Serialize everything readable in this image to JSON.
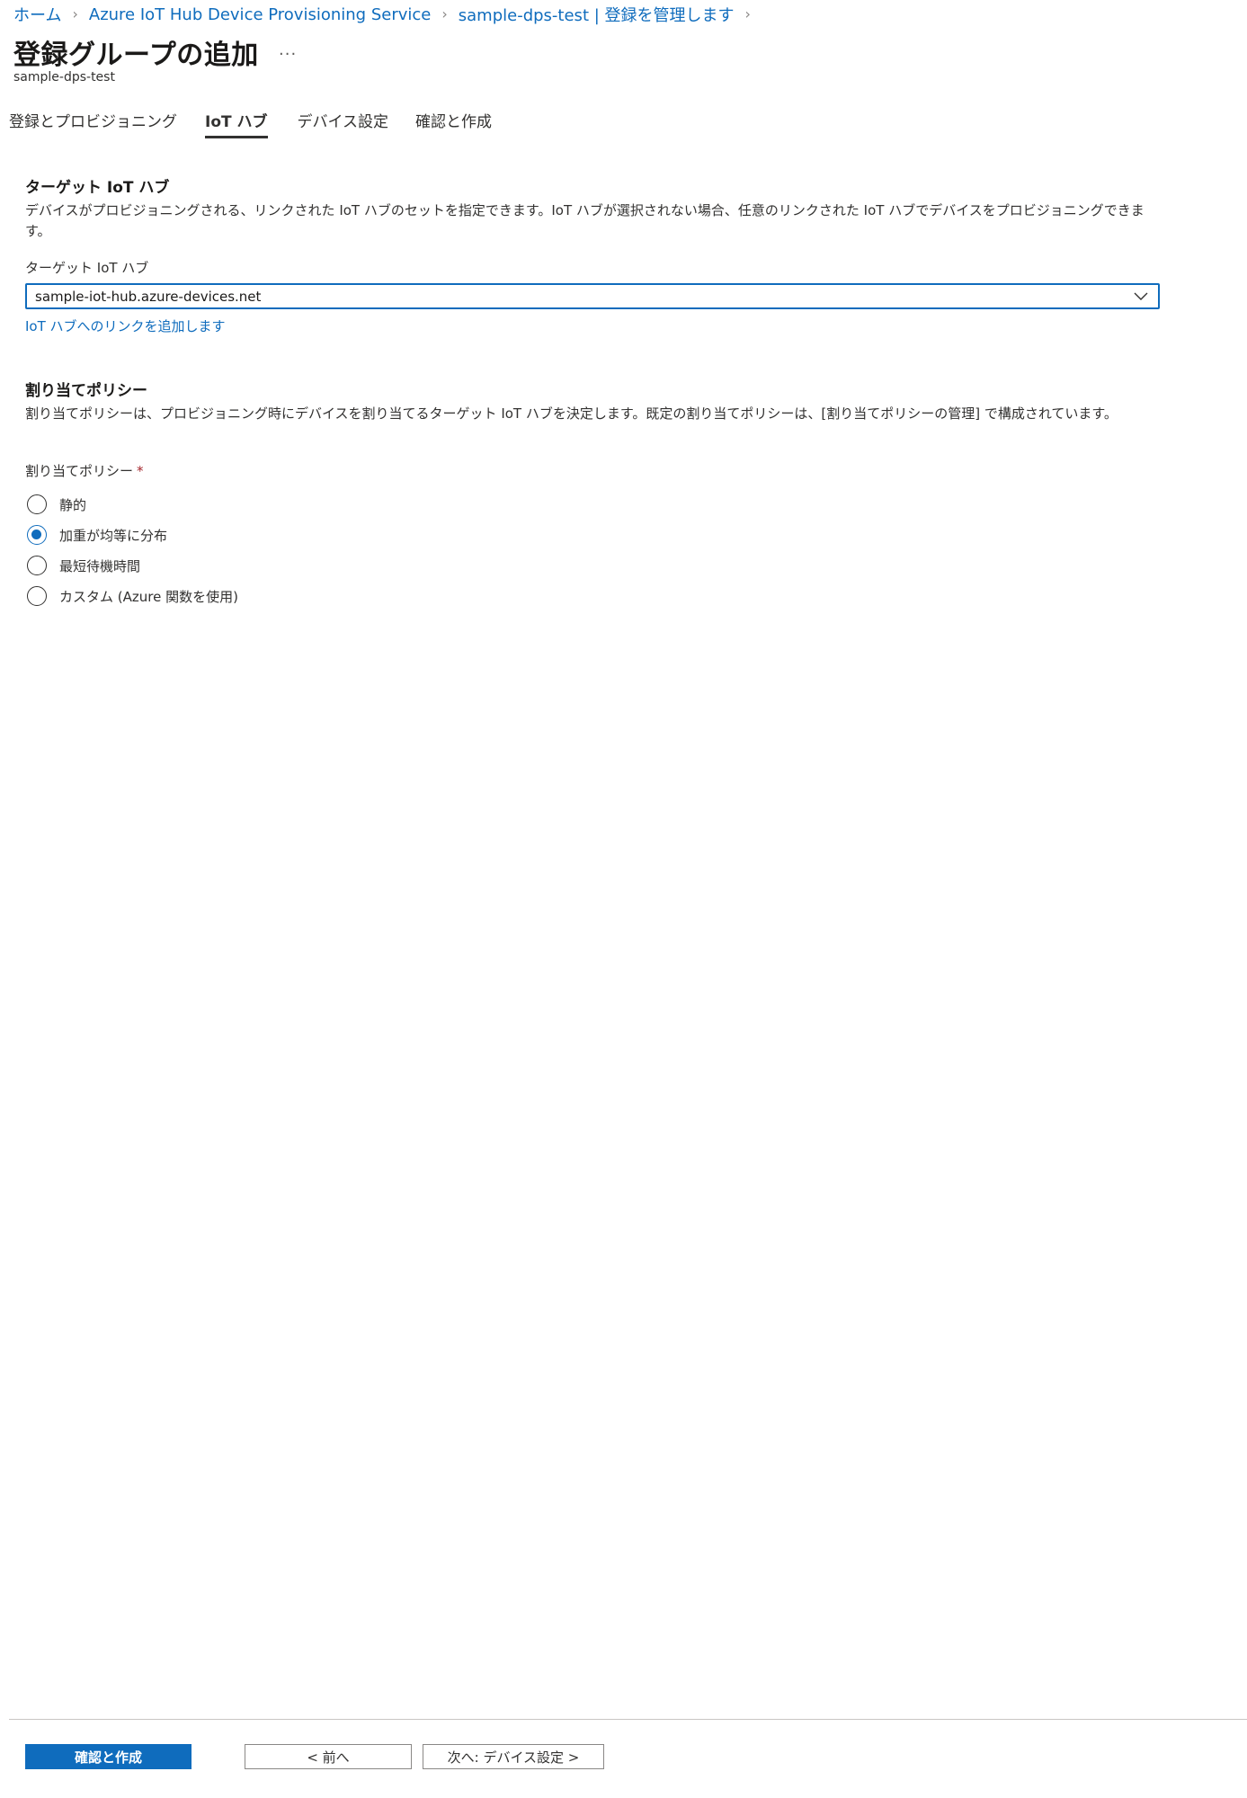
{
  "breadcrumb": {
    "items": [
      "ホーム",
      "Azure IoT Hub Device Provisioning Service",
      "sample-dps-test | 登録を管理します"
    ]
  },
  "header": {
    "title": "登録グループの追加",
    "more": "...",
    "subtitle": "sample-dps-test"
  },
  "tabs": [
    {
      "label": "登録とプロビジョニング",
      "active": false
    },
    {
      "label": "IoT ハブ",
      "active": true
    },
    {
      "label": "デバイス設定",
      "active": false
    },
    {
      "label": "確認と作成",
      "active": false
    }
  ],
  "target_hub": {
    "heading": "ターゲット IoT ハブ",
    "description": "デバイスがプロビジョニングされる、リンクされた IoT ハブのセットを指定できます。IoT ハブが選択されない場合、任意のリンクされた IoT ハブでデバイスをプロビジョニングできます。",
    "field_label": "ターゲット IoT ハブ",
    "selected_value": "sample-iot-hub.azure-devices.net",
    "add_link": "IoT ハブへのリンクを追加します"
  },
  "allocation": {
    "heading": "割り当てポリシー",
    "description": "割り当てポリシーは、プロビジョニング時にデバイスを割り当てるターゲット IoT ハブを決定します。既定の割り当てポリシーは、[割り当てポリシーの管理] で構成されています。",
    "field_label": "割り当てポリシー",
    "required_marker": "*",
    "options": [
      {
        "label": "静的",
        "checked": false
      },
      {
        "label": "加重が均等に分布",
        "checked": true
      },
      {
        "label": "最短待機時間",
        "checked": false
      },
      {
        "label": "カスタム (Azure 関数を使用)",
        "checked": false
      }
    ]
  },
  "footer": {
    "review_create": "確認と作成",
    "previous": "< 前へ",
    "next": "次へ: デバイス設定 >"
  },
  "colors": {
    "accent": "#0f6cbd",
    "text": "#323130",
    "required": "#a4262c"
  }
}
